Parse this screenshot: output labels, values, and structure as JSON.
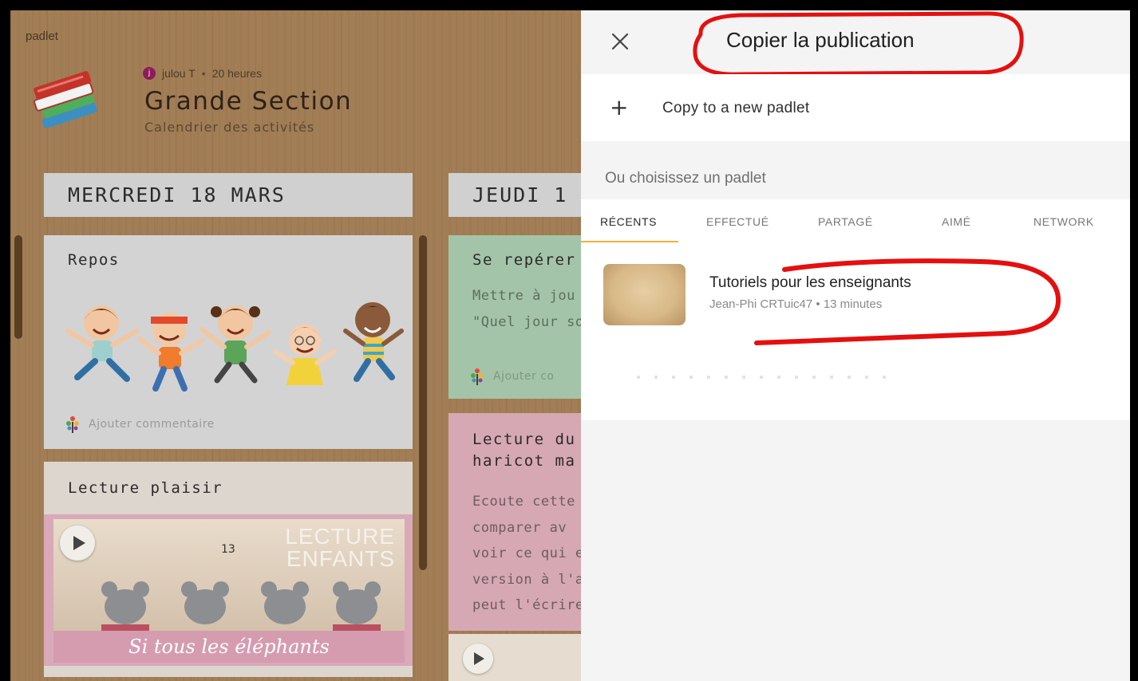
{
  "board": {
    "brand": "padlet",
    "author_initial": "j",
    "author": "julou T",
    "time": "20 heures",
    "title": "Grande Section",
    "subtitle": "Calendrier des activités"
  },
  "columns": [
    {
      "header": "MERCREDI 18 MARS",
      "cards": [
        {
          "title": "Repos",
          "comment_label": "Ajouter commentaire"
        },
        {
          "title": "Lecture plaisir",
          "video_overlay_top": "LECTURE",
          "video_overlay_bottom": "ENFANTS",
          "video_caption": "Si tous les éléphants",
          "page_number": "13"
        }
      ]
    },
    {
      "header": "JEUDI 1",
      "cards": [
        {
          "title": "Se repérer",
          "lines": [
            "Mettre à jou",
            "\"Quel jour so"
          ],
          "comment_label": "Ajouter co"
        },
        {
          "title_lines": [
            "Lecture du",
            "haricot ma"
          ],
          "lines": [
            "Ecoute cette",
            "comparer av",
            "voir ce qui e",
            "version à l'a",
            "peut l'écrire"
          ]
        }
      ]
    }
  ],
  "panel": {
    "title": "Copier la publication",
    "new_padlet_label": "Copy to a new padlet",
    "choose_label": "Ou choisissez un padlet",
    "tabs": [
      "RÉCENTS",
      "EFFECTUÉ",
      "PARTAGÉ",
      "AIMÉ",
      "NETWORK"
    ],
    "active_tab": "RÉCENTS",
    "items": [
      {
        "title": "Tutoriels pour les enseignants",
        "meta": "Jean-Phi CRTuic47 • 13 minutes"
      }
    ]
  },
  "colors": {
    "wood": "#a27e57",
    "annotation_red": "#e4100f",
    "active_tab_underline": "#f2b233",
    "card_grey": "#d3d3d3",
    "card_green": "#a3c4a8",
    "card_pink": "#d6a8b3"
  },
  "icons": [
    "close-icon",
    "plus-icon",
    "play-icon",
    "sprout-icon",
    "books-icon"
  ]
}
